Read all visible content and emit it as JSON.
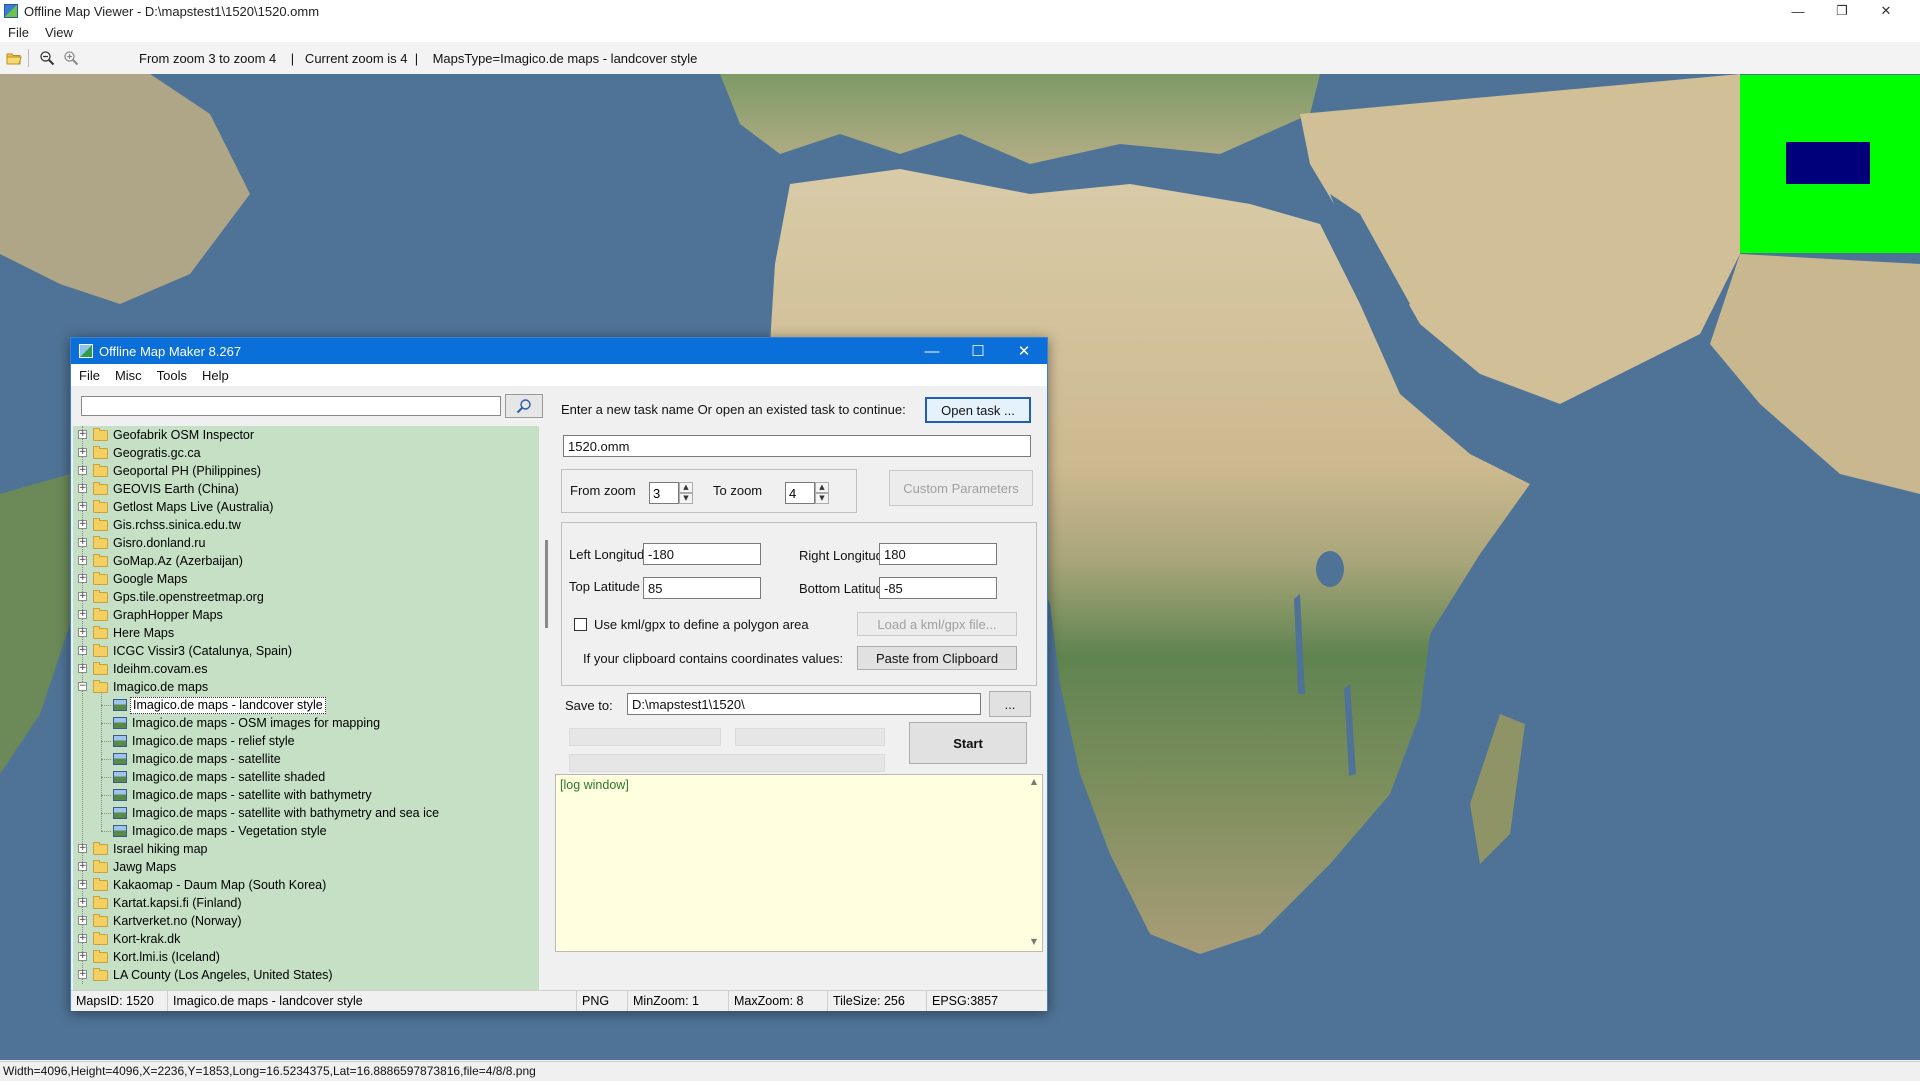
{
  "viewer": {
    "title": "Offline Map Viewer - D:\\mapstest1\\1520\\1520.omm",
    "menu": [
      "File",
      "View"
    ],
    "toolbar_info": "From zoom 3 to zoom 4    |   Current zoom is 4  |    MapsType=Imagico.de maps - landcover style",
    "status": "Width=4096,Height=4096,X=2236,Y=1853,Long=16.5234375,Lat=16.8886597873816,file=4/8/8.png"
  },
  "dialog": {
    "title": "Offline Map Maker 8.267",
    "menu": [
      "File",
      "Misc",
      "Tools",
      "Help"
    ],
    "search": {
      "value": "",
      "placeholder": ""
    },
    "tree": [
      {
        "label": "Geofabrik OSM Inspector",
        "level": 0,
        "type": "folder",
        "expander": "+"
      },
      {
        "label": "Geogratis.gc.ca",
        "level": 0,
        "type": "folder",
        "expander": "+"
      },
      {
        "label": "Geoportal PH (Philippines)",
        "level": 0,
        "type": "folder",
        "expander": "+"
      },
      {
        "label": "GEOVIS Earth (China)",
        "level": 0,
        "type": "folder",
        "expander": "+"
      },
      {
        "label": "Getlost Maps Live (Australia)",
        "level": 0,
        "type": "folder",
        "expander": "+"
      },
      {
        "label": "Gis.rchss.sinica.edu.tw",
        "level": 0,
        "type": "folder",
        "expander": "+"
      },
      {
        "label": "Gisro.donland.ru",
        "level": 0,
        "type": "folder",
        "expander": "+"
      },
      {
        "label": "GoMap.Az (Azerbaijan)",
        "level": 0,
        "type": "folder",
        "expander": "+"
      },
      {
        "label": "Google Maps",
        "level": 0,
        "type": "folder",
        "expander": "+"
      },
      {
        "label": "Gps.tile.openstreetmap.org",
        "level": 0,
        "type": "folder",
        "expander": "+"
      },
      {
        "label": "GraphHopper Maps",
        "level": 0,
        "type": "folder",
        "expander": "+"
      },
      {
        "label": "Here Maps",
        "level": 0,
        "type": "folder",
        "expander": "+"
      },
      {
        "label": "ICGC Vissir3 (Catalunya, Spain)",
        "level": 0,
        "type": "folder",
        "expander": "+"
      },
      {
        "label": "Ideihm.covam.es",
        "level": 0,
        "type": "folder",
        "expander": "+"
      },
      {
        "label": "Imagico.de maps",
        "level": 0,
        "type": "folder-open",
        "expander": "−"
      },
      {
        "label": "Imagico.de maps - landcover style",
        "level": 1,
        "type": "map",
        "selected": true
      },
      {
        "label": "Imagico.de maps - OSM images for mapping",
        "level": 1,
        "type": "map"
      },
      {
        "label": "Imagico.de maps - relief style",
        "level": 1,
        "type": "map"
      },
      {
        "label": "Imagico.de maps - satellite",
        "level": 1,
        "type": "map"
      },
      {
        "label": "Imagico.de maps - satellite shaded",
        "level": 1,
        "type": "map"
      },
      {
        "label": "Imagico.de maps - satellite with bathymetry",
        "level": 1,
        "type": "map"
      },
      {
        "label": "Imagico.de maps - satellite with bathymetry and sea ice",
        "level": 1,
        "type": "map"
      },
      {
        "label": "Imagico.de maps - Vegetation style",
        "level": 1,
        "type": "map"
      },
      {
        "label": "Israel hiking map",
        "level": 0,
        "type": "folder",
        "expander": "+"
      },
      {
        "label": "Jawg Maps",
        "level": 0,
        "type": "folder",
        "expander": "+"
      },
      {
        "label": "Kakaomap - Daum Map (South Korea)",
        "level": 0,
        "type": "folder",
        "expander": "+"
      },
      {
        "label": "Kartat.kapsi.fi (Finland)",
        "level": 0,
        "type": "folder",
        "expander": "+"
      },
      {
        "label": "Kartverket.no (Norway)",
        "level": 0,
        "type": "folder",
        "expander": "+"
      },
      {
        "label": "Kort-krak.dk",
        "level": 0,
        "type": "folder",
        "expander": "+"
      },
      {
        "label": "Kort.lmi.is (Iceland)",
        "level": 0,
        "type": "folder",
        "expander": "+"
      },
      {
        "label": "LA County (Los Angeles, United States)",
        "level": 0,
        "type": "folder",
        "expander": "+"
      }
    ],
    "task": {
      "prompt": "Enter a new task name Or open an existed task to continue:",
      "open_button": "Open task ...",
      "name": "1520.omm"
    },
    "zoom": {
      "from_label": "From zoom",
      "from_value": "3",
      "to_label": "To zoom",
      "to_value": "4",
      "custom_button": "Custom Parameters"
    },
    "bounds": {
      "left_label": "Left Longitude",
      "left_value": "-180",
      "right_label": "Right Longitude",
      "right_value": "180",
      "top_label": "Top Latitude",
      "top_value": "85",
      "bottom_label": "Bottom Latitude",
      "bottom_value": "-85",
      "kml_label": "Use kml/gpx to define a polygon area",
      "kml_checked": false,
      "kml_button": "Load a kml/gpx file...",
      "clipboard_label": "If your clipboard contains coordinates values:",
      "clipboard_button": "Paste from Clipboard"
    },
    "save": {
      "label": "Save to:",
      "path": "D:\\mapstest1\\1520\\",
      "browse_button": "..."
    },
    "start_button": "Start",
    "log_text": "[log window]",
    "status": {
      "maps_id": "MapsID: 1520",
      "maps_name": "Imagico.de maps - landcover style",
      "format": "PNG",
      "min_zoom": "MinZoom: 1",
      "max_zoom": "MaxZoom: 8",
      "tile_size": "TileSize: 256",
      "epsg": "EPSG:3857"
    }
  },
  "colors": {
    "ocean": "#4f7396",
    "desert": "#d8c9a6",
    "savanna": "#a8a878",
    "forest": "#4f7a45",
    "minimap_bg": "#00ff00",
    "minimap_view": "#00007a",
    "dialog_title": "#0a6fd8",
    "tree_bg": "#c5e0c5",
    "log_bg": "#ffffe0"
  }
}
